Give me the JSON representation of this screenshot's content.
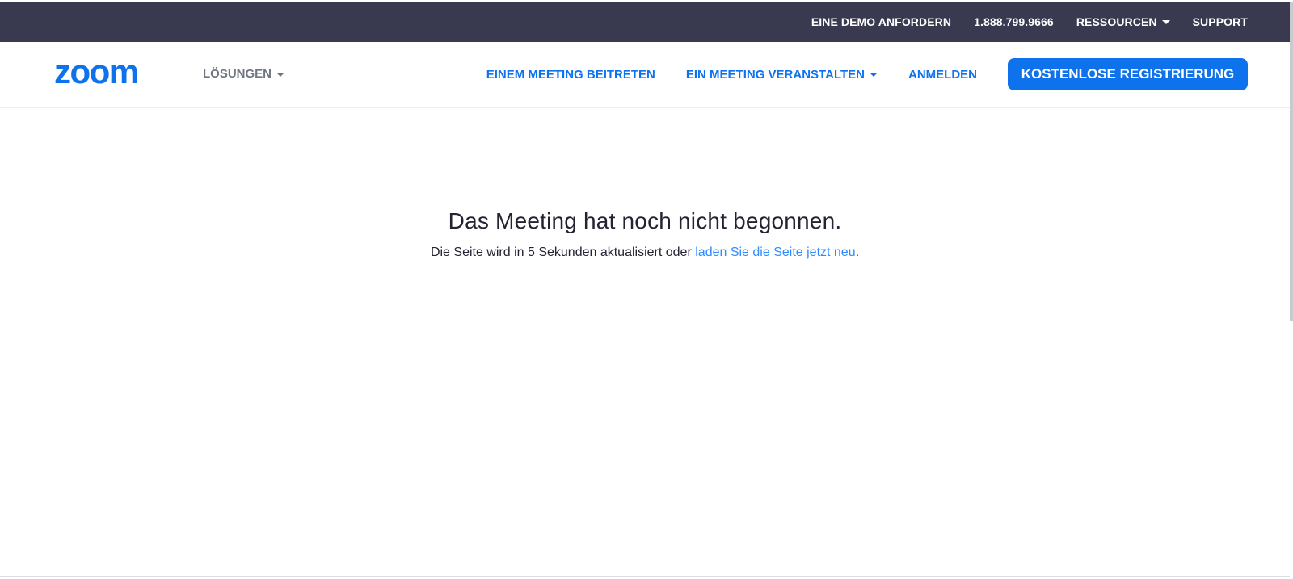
{
  "utility_bar": {
    "demo_label": "EINE DEMO ANFORDERN",
    "phone_label": "1.888.799.9666",
    "resources_label": "RESSOURCEN",
    "support_label": "SUPPORT"
  },
  "nav": {
    "logo_text": "zoom",
    "solutions_label": "LÖSUNGEN",
    "join_label": "EINEM MEETING BEITRETEN",
    "host_label": "EIN MEETING VERANSTALTEN",
    "signin_label": "ANMELDEN",
    "signup_label": "KOSTENLOSE REGISTRIERUNG"
  },
  "content": {
    "headline": "Das Meeting hat noch nicht begonnen.",
    "sub_prefix": "Die Seite wird in 5 Sekunden aktualisiert oder ",
    "reload_link": "laden Sie die Seite jetzt neu",
    "sub_suffix": "."
  },
  "colors": {
    "utility_bg": "#393a4f",
    "brand_blue": "#0e72ed",
    "link_blue": "#2d8cff",
    "text_dark": "#232333"
  },
  "icons": {
    "dropdown": "caret-down-icon"
  }
}
